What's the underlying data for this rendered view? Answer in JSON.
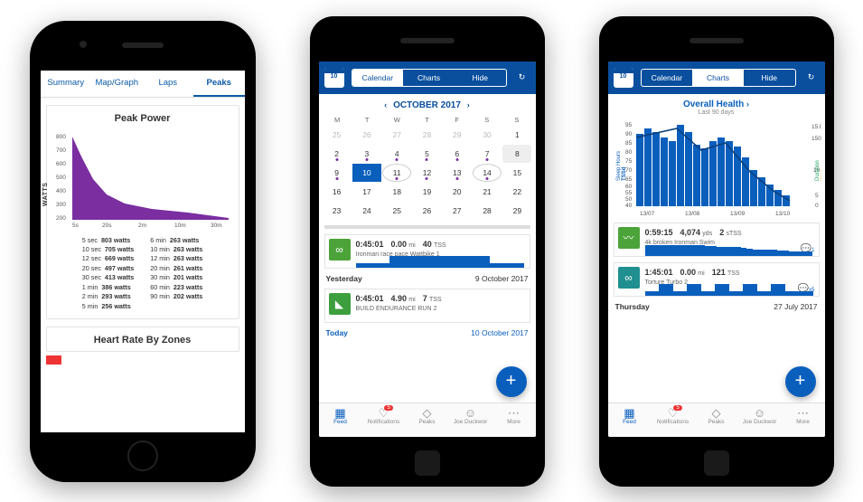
{
  "phone1": {
    "tabs": [
      "Summary",
      "Map/Graph",
      "Laps",
      "Peaks"
    ],
    "active_tab": 3,
    "title": "Peak Power",
    "ylabel": "WATTS",
    "hr_title": "Heart Rate By Zones",
    "stats_left": [
      {
        "t": "5 sec",
        "v": "803 watts"
      },
      {
        "t": "10 sec",
        "v": "705 watts"
      },
      {
        "t": "12 sec",
        "v": "669 watts"
      },
      {
        "t": "20 sec",
        "v": "497 watts"
      },
      {
        "t": "30 sec",
        "v": "413 watts"
      },
      {
        "t": "1 min",
        "v": "386 watts"
      },
      {
        "t": "2 min",
        "v": "293 watts"
      },
      {
        "t": "5 min",
        "v": "256 watts"
      }
    ],
    "stats_right": [
      {
        "t": "6 min",
        "v": "263 watts"
      },
      {
        "t": "10 min",
        "v": "263 watts"
      },
      {
        "t": "12 min",
        "v": "263 watts"
      },
      {
        "t": "20 min",
        "v": "261 watts"
      },
      {
        "t": "30 min",
        "v": "201 watts"
      },
      {
        "t": "60 min",
        "v": "223 watts"
      },
      {
        "t": "90 min",
        "v": "202 watts"
      }
    ]
  },
  "shared": {
    "cal_badge": "10",
    "seg": [
      "Calendar",
      "Charts",
      "Hide"
    ],
    "nav": [
      "Feed",
      "Notifications",
      "Peaks",
      "Joe Duckwor",
      "More"
    ],
    "nav_badge": "5"
  },
  "phone2": {
    "seg_active": 0,
    "month": "OCTOBER 2017",
    "dow": [
      "M",
      "T",
      "W",
      "T",
      "F",
      "S",
      "S"
    ],
    "workout1": {
      "dur": "0:45:01",
      "dist": "0.00",
      "du": "mi",
      "tss": "40",
      "tu": "TSS",
      "name": "Ironman race pace Wattbike 1"
    },
    "yesterday": "Yesterday",
    "ydate": "9 October 2017",
    "workout2": {
      "dur": "0:45:01",
      "dist": "4.90",
      "du": "mi",
      "tss": "7",
      "tu": "TSS",
      "name": "BUILD ENDURANCE RUN 2"
    },
    "today": "Today",
    "tdate": "10 October 2017"
  },
  "phone3": {
    "seg_active": 1,
    "chart_title": "Overall Health",
    "chart_sub": "Last 90 days",
    "left_axis": "Sleep Hours / TSSd",
    "right_axis": "Duration / Injury",
    "xticks": [
      "13/07",
      "13/08",
      "13/09",
      "13/10"
    ],
    "workout1": {
      "dur": "0:59:15",
      "dist": "4,074",
      "du": "yds",
      "tss": "2",
      "tu": "sTSS",
      "name": "4k broken Ironman Swim",
      "comments": "1"
    },
    "workout2": {
      "dur": "1:45:01",
      "dist": "0.00",
      "du": "mi",
      "tss": "121",
      "tu": "TSS",
      "name": "Torture Turbo 2",
      "comments": "x5"
    },
    "dayhdr": "Thursday",
    "daydate": "27 July 2017"
  },
  "chart_data": [
    {
      "type": "area",
      "title": "Peak Power",
      "xlabel": "",
      "ylabel": "WATTS",
      "x": [
        "5s",
        "20s",
        "2m",
        "10m",
        "30m"
      ],
      "y": [
        803,
        497,
        293,
        263,
        202
      ],
      "ylim": [
        200,
        800
      ],
      "yticks": [
        200,
        300,
        400,
        500,
        600,
        700,
        800
      ]
    },
    {
      "type": "bar+line",
      "title": "Overall Health — Last 90 days",
      "x_range": [
        "13/07",
        "13/10"
      ],
      "left_ylim": [
        40,
        95
      ],
      "left_yticks": [
        40,
        50,
        55,
        60,
        65,
        70,
        75,
        80,
        85,
        90,
        95
      ],
      "right_ylim": [
        0,
        15
      ],
      "right_yticks": [
        0,
        5,
        10,
        15,
        150
      ],
      "series": [
        {
          "name": "TSSd (bars)",
          "values": [
            88,
            92,
            90,
            85,
            82,
            95,
            90,
            78,
            75,
            80,
            85,
            82,
            78,
            70,
            60,
            55,
            50,
            48,
            45
          ]
        },
        {
          "name": "Sleep Hours (line)",
          "values": [
            85,
            90,
            88,
            86,
            84,
            92,
            88,
            80,
            78,
            82,
            84,
            81,
            76,
            68,
            58,
            54,
            50,
            48,
            46
          ]
        }
      ]
    }
  ]
}
